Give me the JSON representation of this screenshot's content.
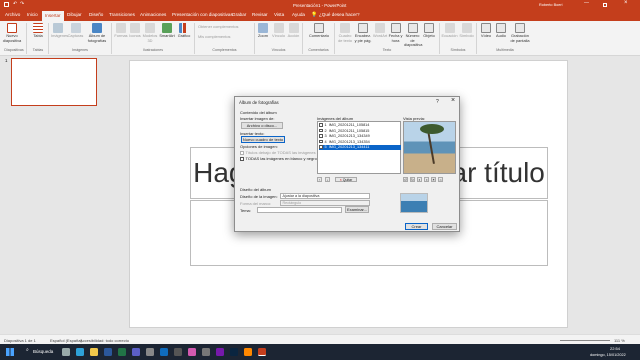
{
  "titlebar": {
    "title": "Presentación1 - PowerPoint",
    "search": "¿Qué desea hacer?",
    "user": "Roberto Boeri"
  },
  "tabs": [
    "Archivo",
    "Inicio",
    "Insertar",
    "Dibujar",
    "Diseño",
    "Transiciones",
    "Animaciones",
    "Presentación con diapositivas",
    "Grabar",
    "Revisar",
    "Vista",
    "Ayuda"
  ],
  "ribbon": {
    "buttons": [
      "Nuevo diapositiva",
      "Tabla",
      "Imágenes",
      "Capturas",
      "Álbum de fotografías",
      "Formas",
      "Iconos",
      "Modelos 3D",
      "SmartArt",
      "Gráfico",
      "Obtener complementos",
      "Mis complementos",
      "Zoom",
      "Vínculo",
      "Acción",
      "Comentario",
      "Cuadro de texto",
      "Encabez. y pie pág.",
      "WordArt",
      "Fecha y hora",
      "Número de diapositiva",
      "Objeto",
      "Ecuación",
      "Símbolo",
      "Vídeo",
      "Audio",
      "Grabación de pantalla"
    ],
    "groups": [
      "Diapositivas",
      "Tablas",
      "Imágenes",
      "Ilustraciones",
      "Complementos",
      "Vínculos",
      "Comentarios",
      "Texto",
      "Símbolos",
      "Multimedia"
    ]
  },
  "thumbnail_number": "1",
  "slide": {
    "title_text": "Haga clic para agregar título"
  },
  "dialog": {
    "title": "Álbum de fotografías",
    "help": "?",
    "close": "×",
    "section_content": "Contenido del álbum",
    "insert_image_from": "Insertar imagen de:",
    "file_disk_button": "Archivo o disco...",
    "insert_text": "Insertar texto:",
    "new_textbox_button": "Nuevo cuadro de texto",
    "image_options": "Opciones de imagen:",
    "option_captions": "Títulos debajo de TODAS las imágenes",
    "option_bw": "TODAS las imágenes en blanco y negro",
    "album_images_label": "Imágenes del álbum",
    "images": [
      "IMG_20201211_105814",
      "IMG_20201211_105815",
      "IMG_20201213_134349",
      "IMG_20201213_134354",
      "IMG_20201213_134411"
    ],
    "selected_index": 4,
    "remove_button": "Quitar",
    "preview_label": "Vista previa:",
    "section_layout": "Diseño del álbum",
    "layout_label": "Diseño de la imagen:",
    "layout_value": "Ajustar a la diapositiva",
    "frame_label": "Forma del marco:",
    "frame_value": "Rectángulo",
    "theme_label": "Tema:",
    "browse_button": "Examinar...",
    "create_button": "Crear",
    "cancel_button": "Cancelar"
  },
  "status": {
    "slide_info": "Diapositiva 1 de 1",
    "language": "Español (España)",
    "accessibility": "Accesibilidad: todo correcto",
    "zoom": "111 %"
  },
  "taskbar": {
    "search": "Búsqueda",
    "time": "22:54",
    "date": "domingo, 15/01/2022"
  }
}
